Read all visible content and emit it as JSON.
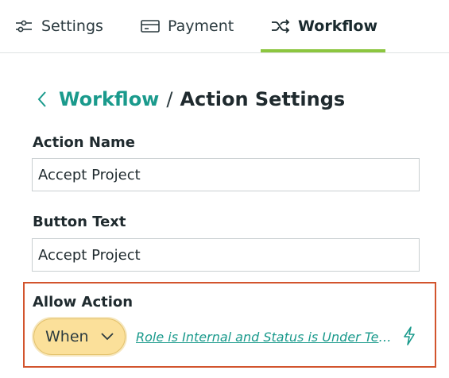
{
  "tabs": [
    {
      "label": "Settings",
      "icon": "sliders-icon"
    },
    {
      "label": "Payment",
      "icon": "credit-card-icon"
    },
    {
      "label": "Workflow",
      "icon": "shuffle-icon",
      "active": true
    }
  ],
  "breadcrumb": {
    "back_icon": "chevron-left-icon",
    "parent": "Workflow",
    "separator": "/",
    "current": "Action Settings"
  },
  "form": {
    "action_name": {
      "label": "Action Name",
      "value": "Accept Project"
    },
    "button_text": {
      "label": "Button Text",
      "value": "Accept Project"
    },
    "allow_action": {
      "label": "Allow Action",
      "when": "When",
      "condition": "Role is Internal and Status is Under Tea...",
      "bolt_icon": "lightning-icon"
    }
  },
  "colors": {
    "accent_teal": "#1a9a8c",
    "active_tab_underline": "#8cc63f",
    "highlight_border": "#d2542d",
    "when_pill_bg": "#fbe09a"
  }
}
